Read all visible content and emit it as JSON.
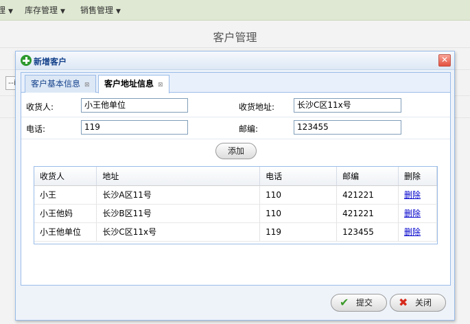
{
  "menubar": {
    "items": [
      {
        "label": "理"
      },
      {
        "label": "库存管理"
      },
      {
        "label": "销售管理"
      }
    ]
  },
  "page": {
    "title": "客户管理",
    "side_button": "--i"
  },
  "dialog": {
    "title": "新增客户",
    "close": "✕",
    "tabs": [
      {
        "label": "客户基本信息"
      },
      {
        "label": "客户地址信息"
      }
    ],
    "form": {
      "receiver_label": "收货人:",
      "receiver_value": "小王他单位",
      "address_label": "收货地址:",
      "address_value": "长沙C区11x号",
      "phone_label": "电话:",
      "phone_value": "119",
      "zip_label": "邮编:",
      "zip_value": "123455"
    },
    "add_label": "添加",
    "grid": {
      "columns": [
        "收货人",
        "地址",
        "电话",
        "邮编",
        "删除"
      ],
      "rows": [
        {
          "receiver": "小王",
          "address": "长沙A区11号",
          "phone": "110",
          "zip": "421221",
          "action": "删除"
        },
        {
          "receiver": "小王他妈",
          "address": "长沙B区11号",
          "phone": "110",
          "zip": "421221",
          "action": "删除"
        },
        {
          "receiver": "小王他单位",
          "address": "长沙C区11x号",
          "phone": "119",
          "zip": "123455",
          "action": "删除"
        }
      ]
    },
    "submit_label": "提交",
    "close_label": "关闭"
  },
  "colors": {
    "accent": "#99bbe8",
    "menubar": "#dfe8d2",
    "link": "#0000cc"
  },
  "icons": [
    "chevron-down-icon",
    "plus-icon",
    "close-icon",
    "tab-close-icon",
    "checkmark-icon",
    "x-icon"
  ]
}
